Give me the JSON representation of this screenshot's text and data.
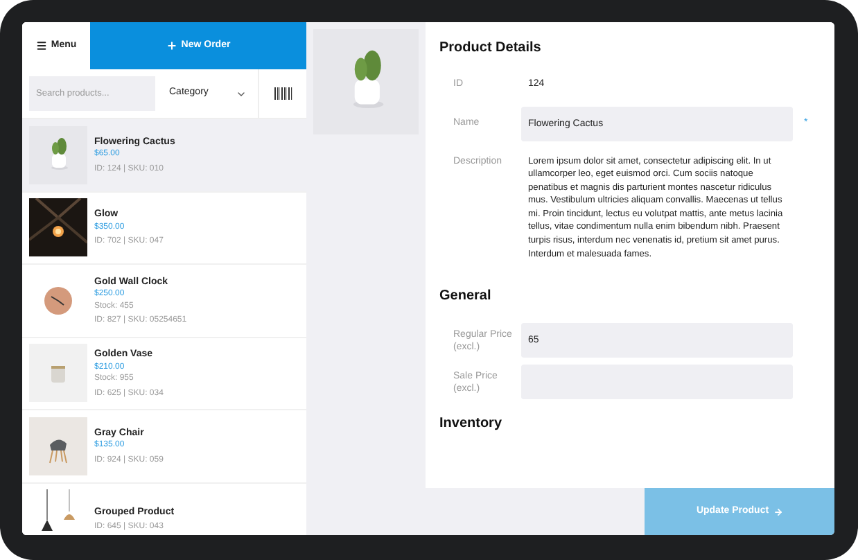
{
  "header": {
    "menu": "Menu",
    "new_order": "New Order"
  },
  "filters": {
    "search_placeholder": "Search products...",
    "category": "Category"
  },
  "products": [
    {
      "name": "Flowering Cactus",
      "price": "$65.00",
      "meta": "ID: 124 | SKU: 010",
      "selected": true
    },
    {
      "name": "Glow",
      "price": "$350.00",
      "meta": "ID: 702 | SKU: 047",
      "selected": false
    },
    {
      "name": "Gold Wall Clock",
      "price": "$250.00",
      "stock": "Stock: 455",
      "meta": "ID: 827 | SKU: 05254651",
      "selected": false
    },
    {
      "name": "Golden Vase",
      "price": "$210.00",
      "stock": "Stock: 955",
      "meta": "ID: 625 | SKU: 034",
      "selected": false
    },
    {
      "name": "Gray Chair",
      "price": "$135.00",
      "meta": "ID: 924 | SKU: 059",
      "selected": false
    },
    {
      "name": "Grouped Product",
      "meta": "ID: 645 | SKU: 043",
      "selected": false
    }
  ],
  "details": {
    "title": "Product Details",
    "id": {
      "label": "ID",
      "value": "124"
    },
    "name": {
      "label": "Name",
      "value": "Flowering Cactus",
      "required_mark": "*"
    },
    "description": {
      "label": "Description",
      "value": "Lorem ipsum dolor sit amet, consectetur adipiscing elit. In ut ullamcorper leo, eget euismod orci. Cum sociis natoque penatibus et magnis dis parturient montes nascetur ridiculus mus. Vestibulum ultricies aliquam convallis. Maecenas ut tellus mi. Proin tincidunt, lectus eu volutpat mattis, ante metus lacinia tellus, vitae condimentum nulla enim bibendum nibh. Praesent turpis risus, interdum nec venenatis id, pretium sit amet purus. Interdum et malesuada fames."
    },
    "general": {
      "title": "General",
      "fields": [
        {
          "label": "Regular Price (excl.)",
          "value": "65"
        },
        {
          "label": "Sale Price (excl.)"
        }
      ]
    },
    "inventory": {
      "title": "Inventory"
    }
  },
  "update_button": "Update Product"
}
